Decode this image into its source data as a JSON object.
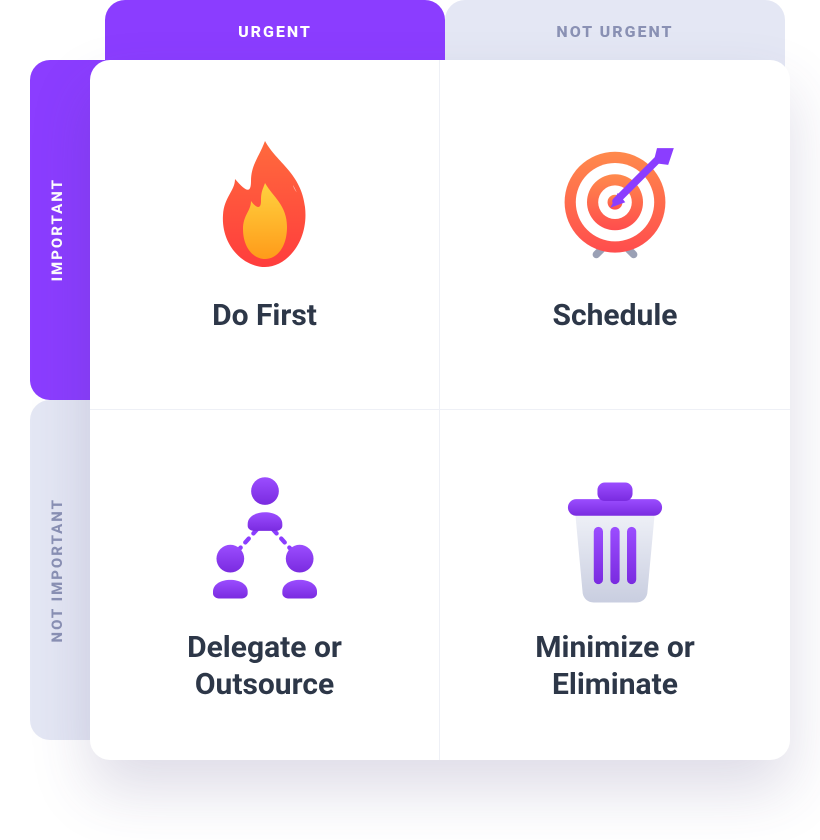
{
  "columns": {
    "urgent": {
      "label": "URGENT"
    },
    "not_urgent": {
      "label": "NOT URGENT"
    }
  },
  "rows": {
    "important": {
      "label": "IMPORTANT"
    },
    "not_important": {
      "label": "NOT IMPORTANT"
    }
  },
  "quadrants": {
    "q1": {
      "label": "Do First",
      "icon": "fire-icon"
    },
    "q2": {
      "label": "Schedule",
      "icon": "target-arrow-icon"
    },
    "q3": {
      "label": "Delegate or Outsource",
      "icon": "people-tree-icon"
    },
    "q4": {
      "label": "Minimize or Eliminate",
      "icon": "trash-icon"
    }
  },
  "colors": {
    "accent": "#8b3dff",
    "muted_tab_bg": "#e4e7f4",
    "muted_tab_fg": "#8a91b4",
    "text": "#2d3748",
    "flame_outer": "#ff5b3a",
    "flame_inner": "#ffb02e",
    "target_outer": "#ff6a3d",
    "target_inner": "#ffffff",
    "trash_body": "#d7dbe8"
  }
}
